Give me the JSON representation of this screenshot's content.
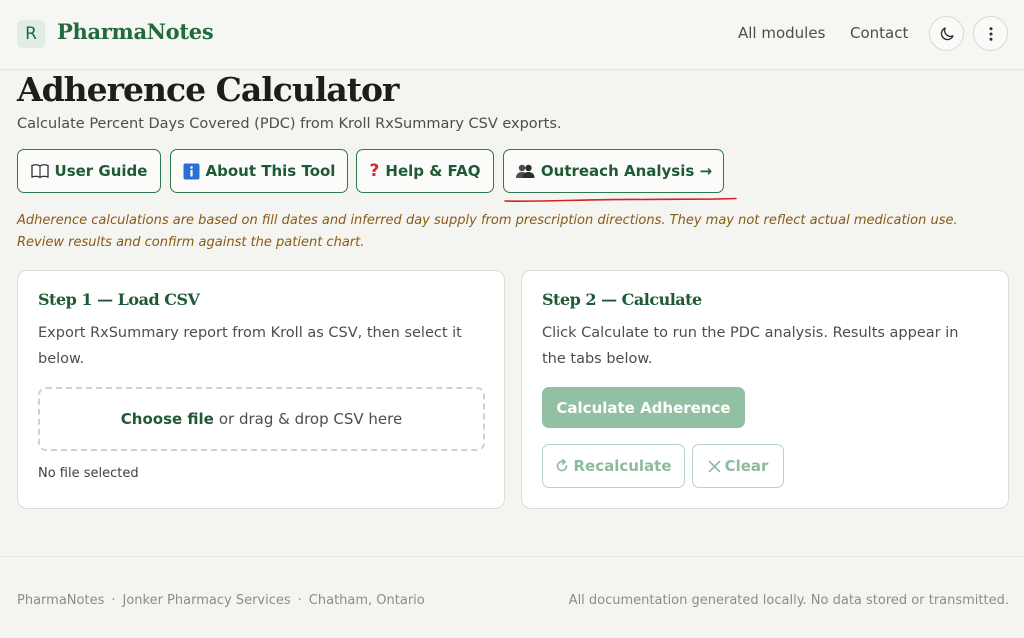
{
  "header": {
    "logo_letter": "R",
    "brand": "PharmaNotes",
    "nav": {
      "modules": "All modules",
      "contact": "Contact"
    }
  },
  "page": {
    "title": "Adherence Calculator",
    "subtitle": "Calculate Percent Days Covered (PDC) from Kroll RxSummary CSV exports."
  },
  "actions": {
    "user_guide": "User Guide",
    "about": "About This Tool",
    "help": "Help & FAQ",
    "outreach": "Outreach Analysis →"
  },
  "disclaimer": "Adherence calculations are based on fill dates and inferred day supply from prescription directions. They may not reflect actual medication use. Review results and confirm against the patient chart.",
  "step1": {
    "title": "Step 1 — Load CSV",
    "description": "Export RxSummary report from Kroll as CSV, then select it below.",
    "choose_file": "Choose file",
    "drop_text": "or drag & drop CSV here",
    "file_status": "No file selected"
  },
  "step2": {
    "title": "Step 2 — Calculate",
    "description": "Click Calculate to run the PDC analysis. Results appear in the tabs below.",
    "calculate": "Calculate Adherence",
    "recalculate": "Recalculate",
    "clear": "Clear"
  },
  "footer": {
    "brand": "PharmaNotes",
    "company": "Jonker Pharmacy Services",
    "location": "Chatham, Ontario",
    "separator": "·",
    "note": "All documentation generated locally. No data stored or transmitted."
  },
  "colors": {
    "brand": "#1f6b3e",
    "warning_text": "#8a5a16",
    "disabled_primary": "#93bfa3",
    "annotation": "#d42020"
  },
  "icons": {
    "theme": "moon-icon",
    "menu": "kebab-menu-icon",
    "user_guide": "book-icon",
    "about": "info-icon",
    "help": "question-mark-icon",
    "outreach": "people-icon",
    "recalculate": "refresh-icon",
    "clear": "close-icon"
  }
}
